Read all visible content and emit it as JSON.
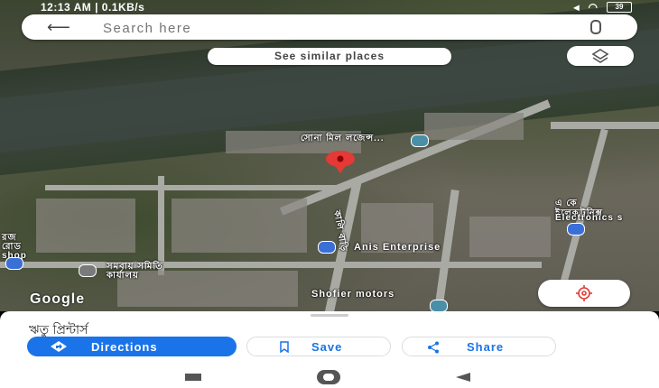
{
  "status": {
    "time": "12:13 AM | 0.1KB/s",
    "battery": "39"
  },
  "search": {
    "placeholder": "Search here"
  },
  "chip": {
    "label": "See similar places"
  },
  "map_labels": {
    "place_name": "সোনা মিল লজেন্স...",
    "road": "কালি বাড়ি",
    "anis": "Anis Enterprise",
    "electronics_bn": "এ কে\nইলেকট্রনিক্স",
    "electronics": "Electronics s",
    "left_label": "রজ\nরোড\nshop",
    "bottom_left": "সমবায় সমিতি\nকার্যালয়",
    "shofier": "Shofier motors"
  },
  "branding": {
    "google": "Google"
  },
  "sheet": {
    "title": "ঋতু প্রিন্টার্স",
    "directions_label": "Directions",
    "save_label": "Save",
    "share_label": "Share"
  },
  "colors": {
    "accent": "#1a73e8",
    "pin": "#e53935",
    "poi_teal": "#4a8fa8",
    "poi_blue": "#3a6fd8"
  }
}
